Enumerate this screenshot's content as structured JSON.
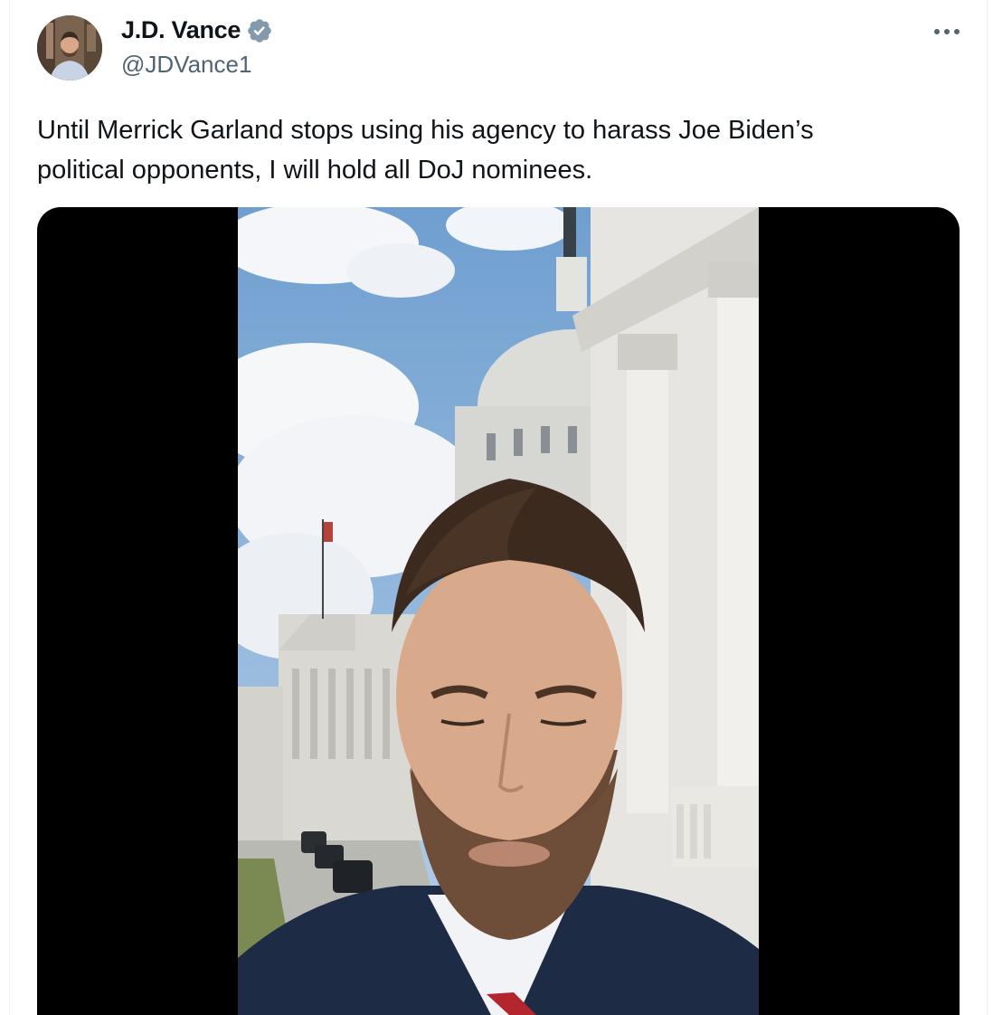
{
  "author": {
    "display_name": "J.D. Vance",
    "handle": "@JDVance1",
    "verified_icon": "verified-badge-icon",
    "avatar_icon": "profile-avatar"
  },
  "tweet": {
    "text_line1": "Until Merrick Garland stops using his agency to harass Joe Biden’s",
    "text_line2": "political opponents, I will hold all DoJ nominees."
  },
  "menu": {
    "icon": "more-options-icon"
  },
  "media": {
    "type": "video",
    "thumbnail_icon": "video-frame"
  },
  "colors": {
    "verified": "#829aab",
    "handle": "#536471",
    "text": "#0f1419"
  }
}
